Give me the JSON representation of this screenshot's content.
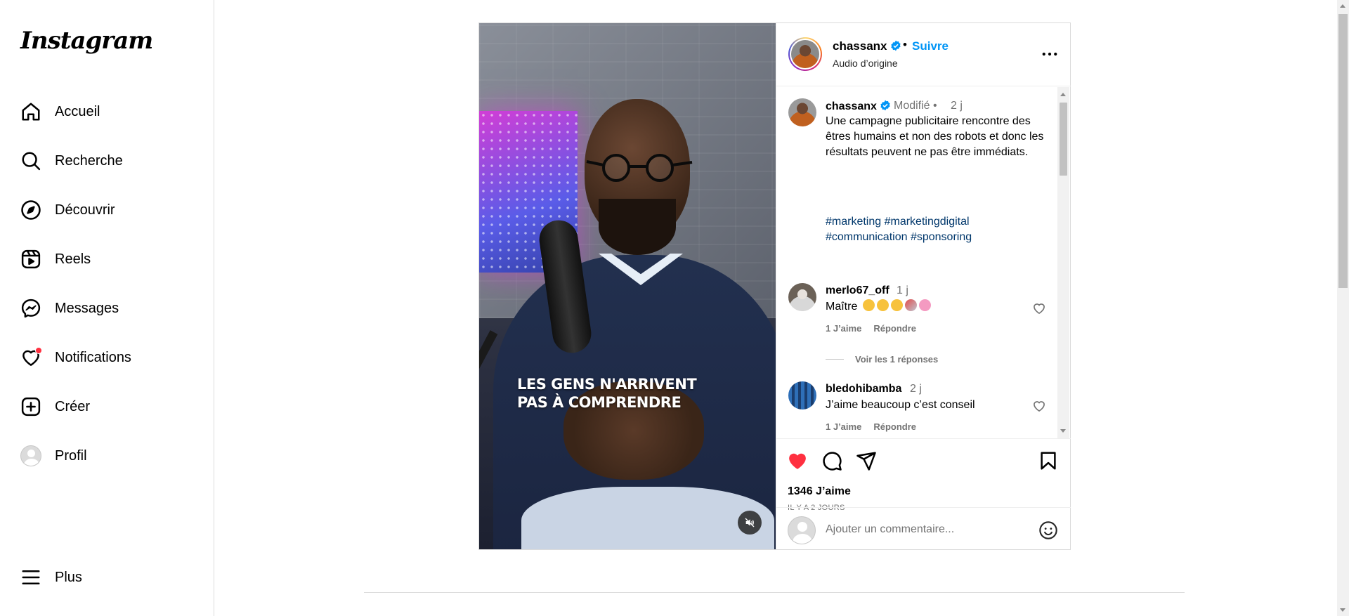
{
  "app": {
    "logo": "Instagram"
  },
  "sidebar": {
    "items": [
      {
        "label": "Accueil",
        "icon": "home-icon"
      },
      {
        "label": "Recherche",
        "icon": "search-icon"
      },
      {
        "label": "Découvrir",
        "icon": "compass-icon"
      },
      {
        "label": "Reels",
        "icon": "reels-icon"
      },
      {
        "label": "Messages",
        "icon": "messenger-icon"
      },
      {
        "label": "Notifications",
        "icon": "heart-icon"
      },
      {
        "label": "Créer",
        "icon": "plus-square-icon"
      },
      {
        "label": "Profil",
        "icon": "avatar"
      }
    ],
    "more": {
      "label": "Plus",
      "icon": "menu-icon"
    },
    "notification_dot_color": "#ff3040"
  },
  "post": {
    "author": {
      "username": "chassanx",
      "verified": true
    },
    "follow_label": "Suivre",
    "separator": "•",
    "audio": "Audio d’origine",
    "video_overlay_text": [
      "LES GENS N'ARRIVENT",
      "PAS À COMPRENDRE"
    ],
    "caption": {
      "username": "chassanx",
      "edited": "Modifié •",
      "time": "2 j",
      "text": "Une campagne publicitaire rencontre des êtres humains et non des robots et donc les résultats peuvent ne pas être immédiats.",
      "hashtags_line1": "#marketing #marketingdigital",
      "hashtags_line2": "#communication #sponsoring"
    },
    "comments": [
      {
        "username": "merlo67_off",
        "time": "1 j",
        "text": "Maître",
        "emojis": [
          "flexed-biceps",
          "flexed-biceps",
          "flexed-biceps",
          "rocket",
          "brain"
        ],
        "likes": "1 J’aime",
        "reply": "Répondre",
        "view_replies": "Voir les 1 réponses"
      },
      {
        "username": "bledohibamba",
        "time": "2 j",
        "text": "J’aime beaucoup c’est conseil",
        "likes": "1 J’aime",
        "reply": "Répondre"
      }
    ],
    "likes": "1346 J’aime",
    "time_ago": "IL Y A 2 JOURS",
    "add_comment_placeholder": "Ajouter un commentaire...",
    "colors": {
      "accent": "#0095f6",
      "like_red": "#ff3040",
      "hashtag": "#00376b"
    }
  }
}
